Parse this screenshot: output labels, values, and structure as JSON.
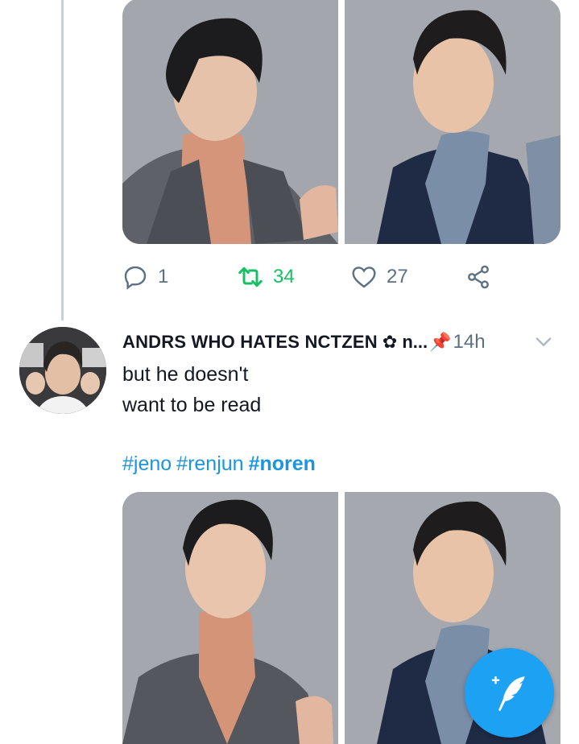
{
  "tweet1": {
    "reply_count": "1",
    "retweet_count": "34",
    "like_count": "27"
  },
  "tweet2": {
    "display_name": "ANDRS WHO HATES NCTZEN",
    "handle_truncated": "n...",
    "time": "14h",
    "text_line1": "but he doesn't",
    "text_line2": "want to be read",
    "hashtags": [
      "#jeno",
      "#renjun",
      "#noren"
    ]
  },
  "colors": {
    "accent": "#1da1f2",
    "retweet_active": "#17bf63",
    "hashtag": "#1b95e0",
    "muted": "#5b7083"
  },
  "icons": {
    "reply": "reply-icon",
    "retweet": "retweet-icon",
    "like": "heart-icon",
    "share": "share-icon",
    "more": "chevron-down-icon",
    "compose": "compose-tweet-icon"
  }
}
